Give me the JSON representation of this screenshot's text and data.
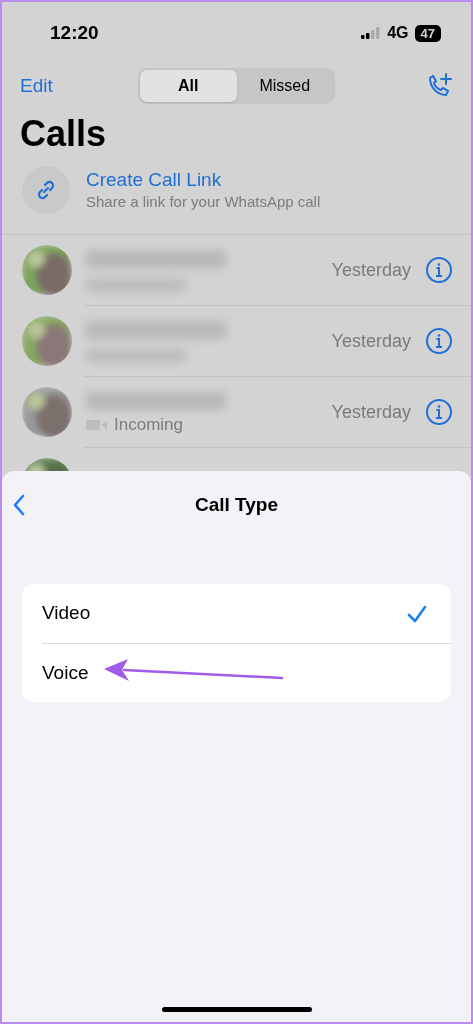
{
  "status_bar": {
    "time": "12:20",
    "network": "4G",
    "battery": "47"
  },
  "nav": {
    "edit": "Edit",
    "segments": [
      {
        "label": "All",
        "selected": true
      },
      {
        "label": "Missed",
        "selected": false
      }
    ]
  },
  "title": "Calls",
  "call_link": {
    "title": "Create Call Link",
    "subtitle": "Share a link for your WhatsApp call"
  },
  "calls": [
    {
      "time": "Yesterday"
    },
    {
      "time": "Yesterday"
    },
    {
      "time": "Yesterday",
      "subtitle": "Incoming"
    },
    {
      "kind": "partial"
    }
  ],
  "sheet": {
    "title": "Call Type",
    "options": [
      {
        "label": "Video",
        "checked": true
      },
      {
        "label": "Voice",
        "checked": false
      }
    ]
  }
}
